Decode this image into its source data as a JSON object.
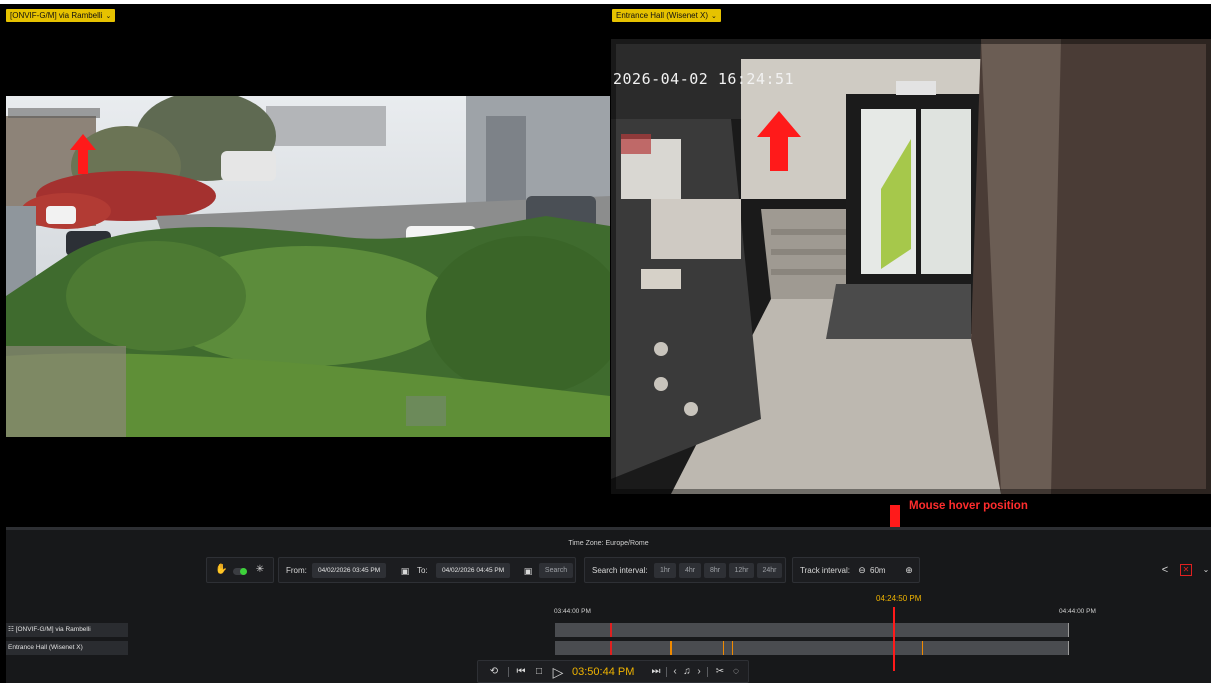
{
  "cameras": [
    {
      "label": "[ONVIF-G/M] via Rambelli"
    },
    {
      "label": "Entrance Hall (Wisenet X)"
    }
  ],
  "overlay": {
    "right_timestamp": "2026-04-02 16:24:51"
  },
  "annotation": {
    "hover_caption": "Mouse hover position",
    "arrow_color": "#ff1a1a"
  },
  "panel": {
    "timezone": "Time Zone: Europe/Rome",
    "from_label": "From:",
    "from_value": "04/02/2026 03:45 PM",
    "to_label": "To:",
    "to_value": "04/02/2026 04:45 PM",
    "search_button": "Search",
    "search_interval_label": "Search interval:",
    "search_intervals": [
      "1hr",
      "4hr",
      "8hr",
      "12hr",
      "24hr"
    ],
    "track_interval_label": "Track interval:",
    "track_interval_value": "60m",
    "icons": {
      "hand": "hand-icon",
      "toggle": "toggle-icon",
      "sparkle": "motion-icon",
      "calendar": "calendar-icon",
      "zoom_out": "zoom-out-icon",
      "zoom_in": "zoom-in-icon",
      "share": "share-icon",
      "close": "close-icon"
    }
  },
  "timeline": {
    "start_label": "03:44:00 PM",
    "end_label": "04:44:00 PM",
    "hover_time": "04:24:50 PM",
    "tracks": [
      {
        "label": "☷ [ONVIF-G/M] via Rambelli"
      },
      {
        "label": "Entrance Hall (Wisenet X)"
      }
    ],
    "colors": {
      "track": "#4a4c50",
      "red_event": "#e02020",
      "orange_event": "#f08a00",
      "hover": "#ff1a1a",
      "accent": "#f0b400"
    }
  },
  "playback": {
    "current_time": "03:50:44 PM"
  }
}
